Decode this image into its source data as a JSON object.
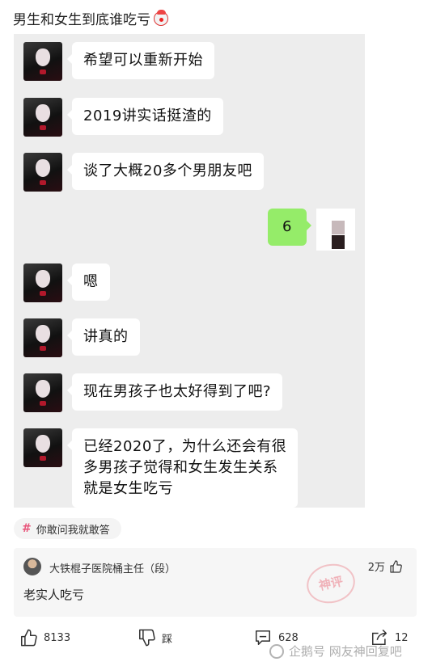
{
  "post": {
    "title": "男生和女生到底谁吃亏",
    "title_emoji": "clown-face-icon"
  },
  "chat": {
    "messages": [
      {
        "side": "left",
        "text": "希望可以重新开始"
      },
      {
        "side": "left",
        "text": "2019讲实话挺渣的"
      },
      {
        "side": "left",
        "text": "谈了大概20多个男朋友吧"
      },
      {
        "side": "right",
        "text": "6"
      },
      {
        "side": "left",
        "text": "嗯"
      },
      {
        "side": "left",
        "text": "讲真的"
      },
      {
        "side": "left",
        "text": "现在男孩子也太好得到了吧?"
      },
      {
        "side": "left",
        "lines": [
          "已经2020了，为什么还会有很",
          "多男孩子觉得和女生发生关系",
          "就是女生吃亏"
        ]
      }
    ]
  },
  "topic": {
    "tag": "你敢问我就敢答"
  },
  "hot_comment": {
    "author": "大铁棍子医院桶主任（段）",
    "likes": "2万",
    "text": "老实人吃亏",
    "stamp_text": "神评"
  },
  "actions": {
    "like_count": "8133",
    "dislike_label": "踩",
    "comment_count": "628",
    "share_count": "12"
  },
  "watermark": "企鹅号 网友神回复吧",
  "colors": {
    "chat_background": "#ededed",
    "own_bubble": "#95ec69",
    "other_bubble": "#ffffff",
    "topic_hash": "#e8567b"
  }
}
